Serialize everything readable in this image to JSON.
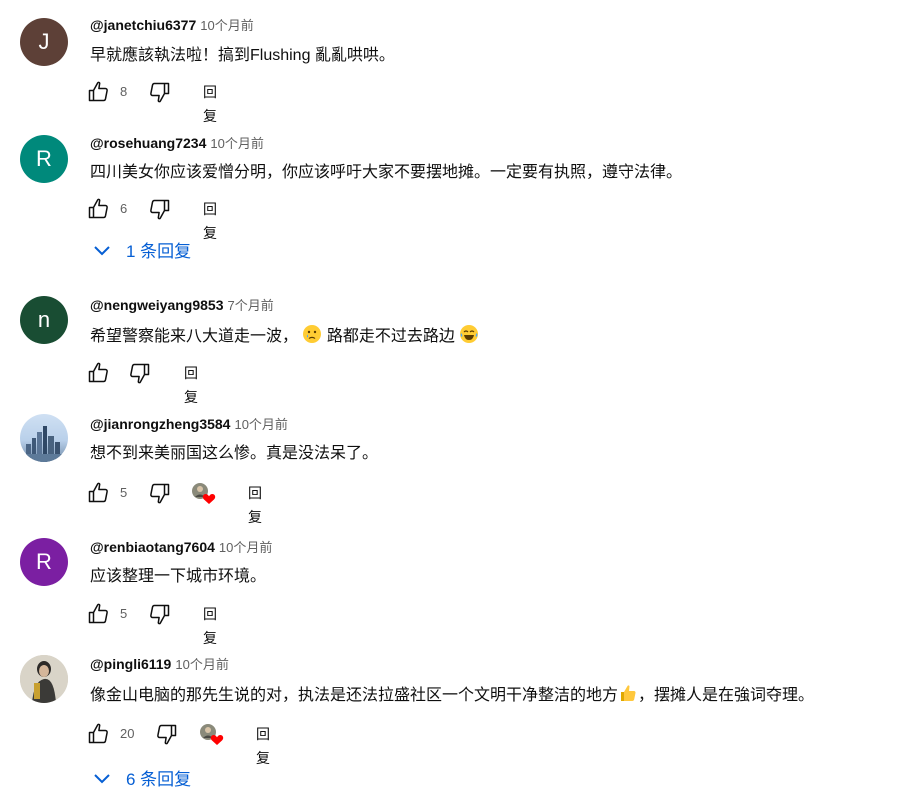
{
  "colors": {
    "avatar_j": "#5d4037",
    "avatar_r1": "#00897b",
    "avatar_n": "#194d33",
    "avatar_r2": "#7b1fa2",
    "link": "#065fd4",
    "secondary": "#606060",
    "heart": "#ff0000"
  },
  "ui": {
    "reply_label": "回复"
  },
  "comments": [
    {
      "avatar": "J",
      "handle": "@janetchiu6377",
      "time": "10个月前",
      "text": "早就應該執法啦！搞到Flushing 亂亂哄哄。",
      "likes": "8"
    },
    {
      "avatar": "R",
      "handle": "@rosehuang7234",
      "time": "10个月前",
      "text": "四川美女你应该爱憎分明，你应该呼吁大家不要摆地摊。一定要有执照，遵守法律。",
      "likes": "6",
      "replies": "1 条回复"
    },
    {
      "avatar": "n",
      "handle": "@nengweiyang9853",
      "time": "7个月前",
      "text_a": "希望警察能来八大道走一波，",
      "text_b": "路都走不过去路边"
    },
    {
      "handle": "@jianrongzheng3584",
      "time": "10个月前",
      "text": "想不到来美丽国这么惨。真是没法呆了。",
      "likes": "5"
    },
    {
      "avatar": "R",
      "handle": "@renbiaotang7604",
      "time": "10个月前",
      "text": "应该整理一下城市环境。",
      "likes": "5"
    },
    {
      "handle": "@pingli6119",
      "time": "10个月前",
      "text_a": "像金山电脑的那先生说的对，执法是还法拉盛社区一个文明干净整洁的地方",
      "text_b": "，摆摊人是在強词夺理。",
      "likes": "20",
      "replies": "6 条回复"
    }
  ]
}
